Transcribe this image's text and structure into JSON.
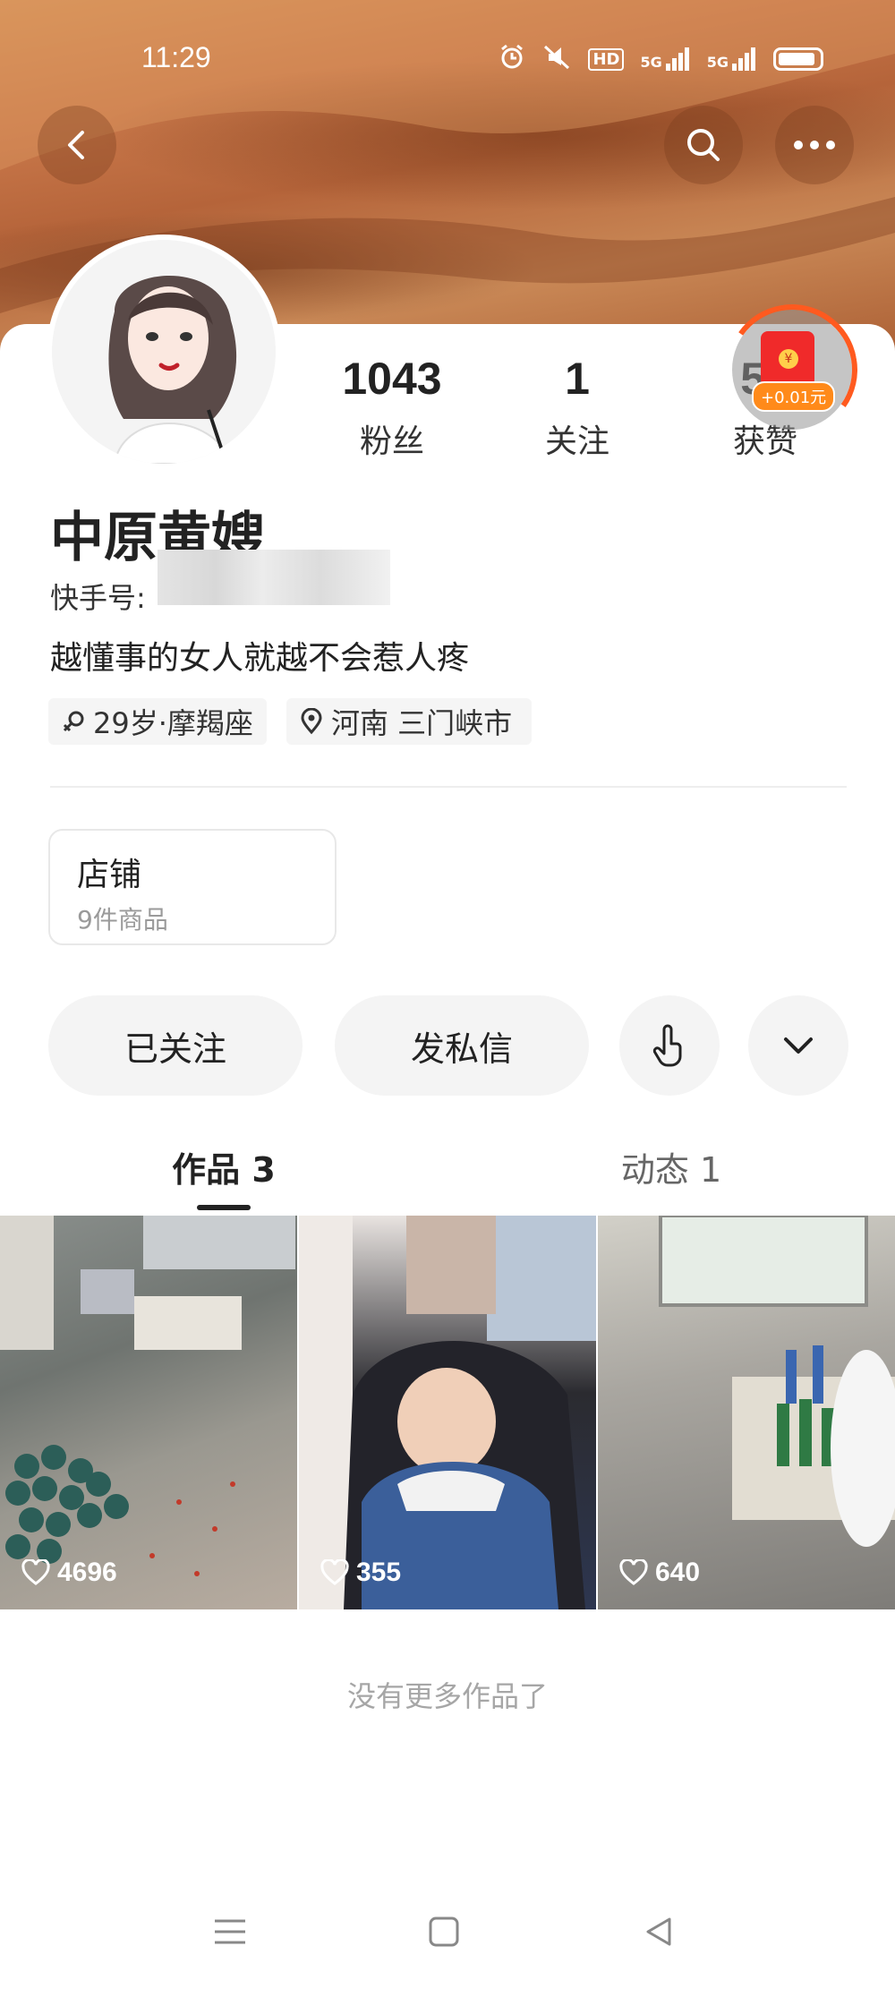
{
  "status_bar": {
    "time": "11:29",
    "icons": [
      "alarm-icon",
      "mute-icon",
      "hd-icon",
      "5g-signal-icon",
      "5g-signal-icon",
      "battery-icon"
    ],
    "hd_label": "HD",
    "net1": "5G",
    "net2": "5G"
  },
  "header": {
    "back_icon": "back-arrow-icon",
    "search_icon": "search-icon",
    "more_icon": "more-icon"
  },
  "profile": {
    "stats": [
      {
        "value": "1043",
        "label": "粉丝"
      },
      {
        "value": "1",
        "label": "关注"
      },
      {
        "value": "56",
        "label": "获赞"
      }
    ],
    "red_packet_amount": "+0.01元",
    "name": "中原黄嫂",
    "kuaishou_id_label": "快手号:",
    "bio": "越懂事的女人就越不会惹人疼",
    "tags": [
      {
        "icon": "female-icon",
        "text": "29岁·摩羯座"
      },
      {
        "icon": "location-icon",
        "text": "河南 三门峡市"
      }
    ]
  },
  "shop": {
    "title": "店铺",
    "subtitle": "9件商品"
  },
  "actions": {
    "followed_label": "已关注",
    "message_label": "发私信",
    "tap_icon": "tap-hand-icon",
    "expand_icon": "chevron-down-icon"
  },
  "tabs": [
    {
      "label": "作品 3",
      "active": true
    },
    {
      "label": "动态 1",
      "active": false
    }
  ],
  "works": [
    {
      "likes": "4696"
    },
    {
      "likes": "355"
    },
    {
      "likes": "640"
    }
  ],
  "footer_text": "没有更多作品了",
  "nav_bar": [
    "menu-icon",
    "home-square-icon",
    "back-triangle-icon"
  ],
  "colors": {
    "banner": "#c27745",
    "accent_red": "#f02a2a",
    "accent_orange": "#ff8a1a"
  }
}
